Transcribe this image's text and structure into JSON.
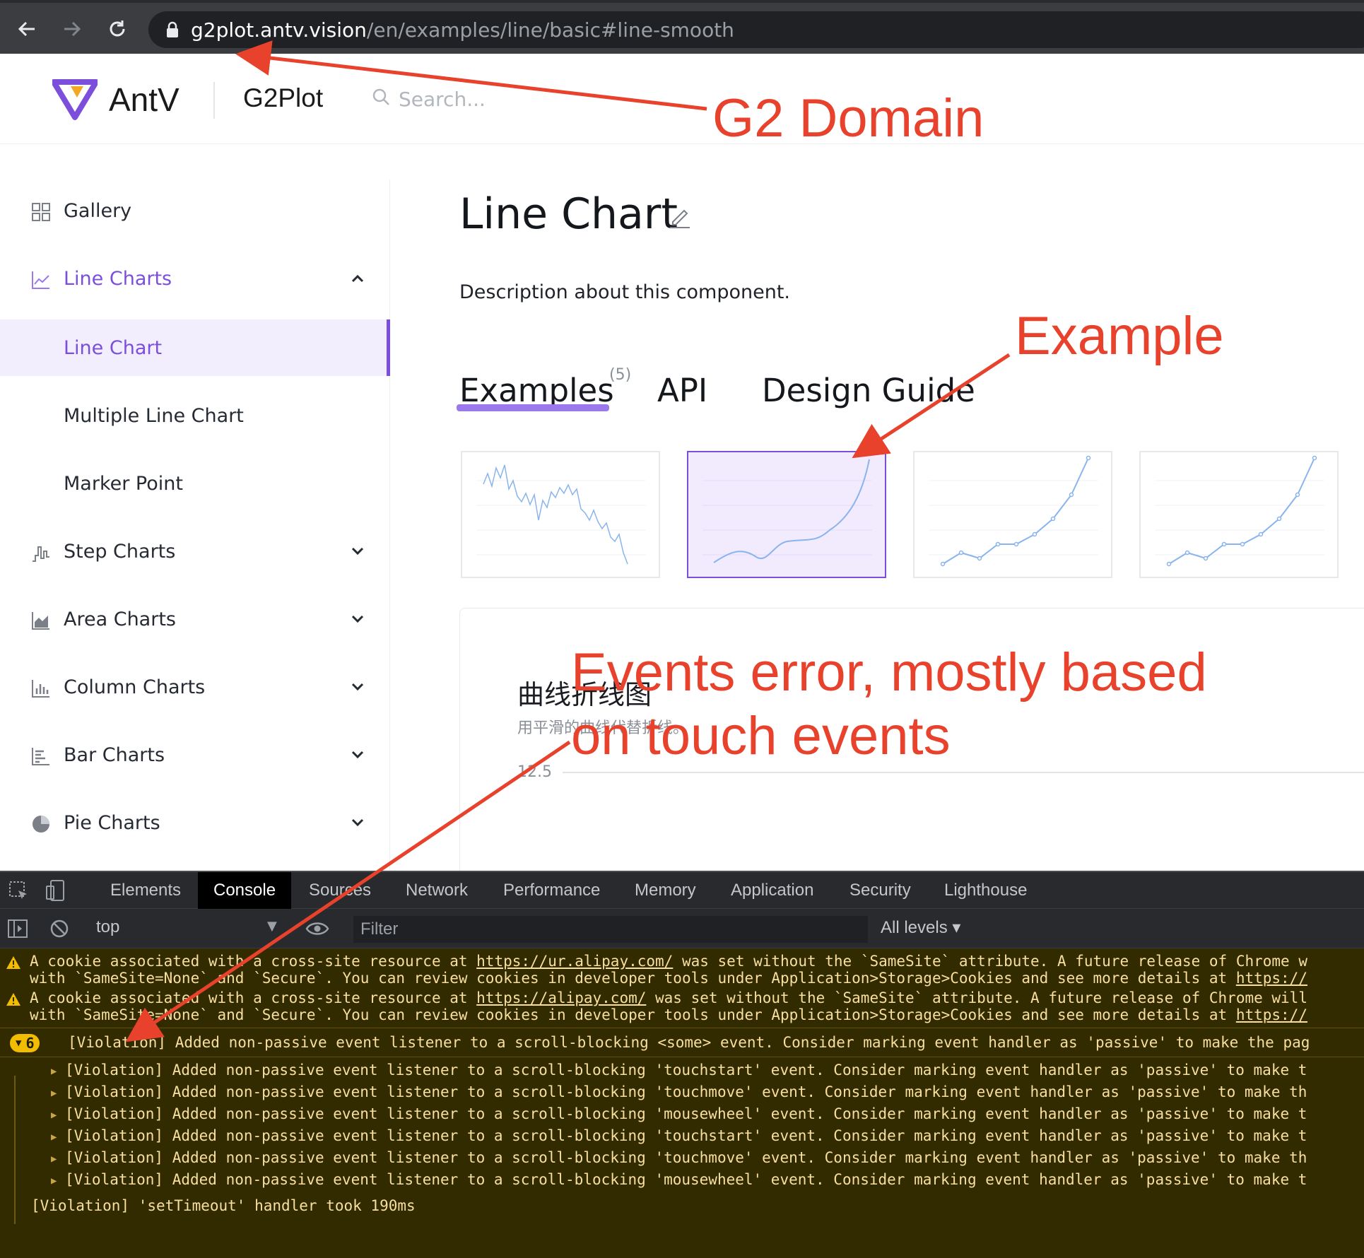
{
  "browser": {
    "url_host": "g2plot.antv.vision",
    "url_path": "/en/examples/line/basic#line-smooth"
  },
  "header": {
    "brand": "AntV",
    "product": "G2Plot",
    "search_placeholder": "Search..."
  },
  "sidebar": {
    "items": [
      {
        "label": "Gallery",
        "icon": "grid-icon"
      },
      {
        "label": "Line Charts",
        "icon": "line-chart-icon"
      },
      {
        "label": "Line Chart"
      },
      {
        "label": "Multiple Line Chart"
      },
      {
        "label": "Marker Point"
      },
      {
        "label": "Step Charts",
        "icon": "step-chart-icon"
      },
      {
        "label": "Area Charts",
        "icon": "area-chart-icon"
      },
      {
        "label": "Column Charts",
        "icon": "column-chart-icon"
      },
      {
        "label": "Bar Charts",
        "icon": "bar-chart-icon"
      },
      {
        "label": "Pie Charts",
        "icon": "pie-chart-icon"
      }
    ]
  },
  "main": {
    "title": "Line Chart",
    "description": "Description about this component.",
    "tabs": [
      {
        "label": "Examples",
        "count": "(5)"
      },
      {
        "label": "API"
      },
      {
        "label": "Design Guide"
      }
    ],
    "example": {
      "title": "曲线折线图",
      "subtitle": "用平滑的曲线代替折线。",
      "tick": "12.5"
    }
  },
  "devtools": {
    "tabs": [
      "Elements",
      "Console",
      "Sources",
      "Network",
      "Performance",
      "Memory",
      "Application",
      "Security",
      "Lighthouse"
    ],
    "active_tab": "Console",
    "context": "top",
    "filter_placeholder": "Filter",
    "levels": "All levels ▾",
    "messages": [
      {
        "pre": "A cookie associated with a cross-site resource at ",
        "link": "https://ur.alipay.com/",
        "post": " was set without the `SameSite` attribute. A future release of Chrome w",
        "line2": "with `SameSite=None` and `Secure`. You can review cookies in developer tools under Application>Storage>Cookies and see more details at ",
        "line2_link": "https://"
      },
      {
        "pre": "A cookie associated with a cross-site resource at ",
        "link": "https://alipay.com/",
        "post": " was set without the `SameSite` attribute. A future release of Chrome will",
        "line2": "with `SameSite=None` and `Secure`. You can review cookies in developer tools under Application>Storage>Cookies and see more details at ",
        "line2_link": "https://"
      }
    ],
    "group": {
      "count": "6",
      "text": "[Violation] Added non-passive event listener to a scroll-blocking <some> event. Consider marking event handler as 'passive' to make the pag"
    },
    "children": [
      "[Violation] Added non-passive event listener to a scroll-blocking 'touchstart' event. Consider marking event handler as 'passive' to make t",
      "[Violation] Added non-passive event listener to a scroll-blocking 'touchmove' event. Consider marking event handler as 'passive' to make th",
      "[Violation] Added non-passive event listener to a scroll-blocking 'mousewheel' event. Consider marking event handler as 'passive' to make t",
      "[Violation] Added non-passive event listener to a scroll-blocking 'touchstart' event. Consider marking event handler as 'passive' to make t",
      "[Violation] Added non-passive event listener to a scroll-blocking 'touchmove' event. Consider marking event handler as 'passive' to make th",
      "[Violation] Added non-passive event listener to a scroll-blocking 'mousewheel' event. Consider marking event handler as 'passive' to make t"
    ],
    "last": "[Violation] 'setTimeout' handler took 190ms"
  },
  "annotations": {
    "domain": "G2 Domain",
    "example": "Example",
    "events_line1": "Events error, mostly based",
    "events_line2": "on touch events"
  },
  "colors": {
    "accent": "#7b4fdb",
    "annotation": "#e8412c",
    "console_warning_bg": "#332b00",
    "console_warning_text": "#f8dfa0"
  }
}
